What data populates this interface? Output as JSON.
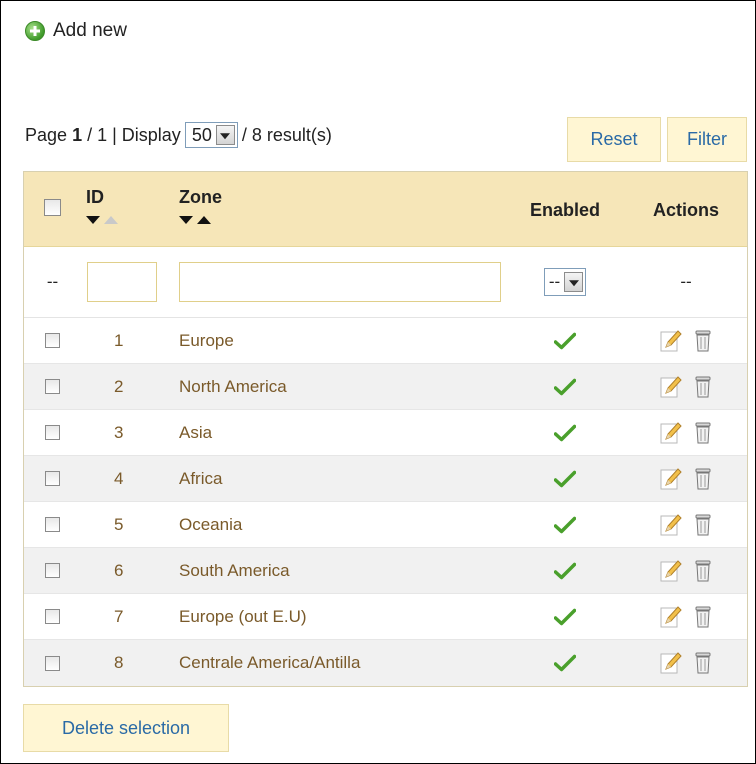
{
  "toolbar": {
    "add_new_label": "Add new"
  },
  "pagination": {
    "page_label": "Page",
    "current_page": "1",
    "separator": "/ 1 | Display",
    "display_value": "50",
    "results_text": "/ 8 result(s)"
  },
  "buttons": {
    "reset": "Reset",
    "filter": "Filter",
    "delete_selection": "Delete selection"
  },
  "table": {
    "headers": {
      "id": "ID",
      "zone": "Zone",
      "enabled": "Enabled",
      "actions": "Actions"
    },
    "filter": {
      "dash_left": "--",
      "enabled_select": "--",
      "dash_right": "--",
      "id_value": "",
      "zone_value": ""
    },
    "rows": [
      {
        "id": "1",
        "zone": "Europe",
        "enabled": true
      },
      {
        "id": "2",
        "zone": "North America",
        "enabled": true
      },
      {
        "id": "3",
        "zone": "Asia",
        "enabled": true
      },
      {
        "id": "4",
        "zone": "Africa",
        "enabled": true
      },
      {
        "id": "5",
        "zone": "Oceania",
        "enabled": true
      },
      {
        "id": "6",
        "zone": "South America",
        "enabled": true
      },
      {
        "id": "7",
        "zone": "Europe (out E.U)",
        "enabled": true
      },
      {
        "id": "8",
        "zone": "Centrale America/Antilla",
        "enabled": true
      }
    ]
  },
  "colors": {
    "header_bg": "#f6e6b8",
    "button_bg": "#fff6d3",
    "link_blue": "#2a6aa6",
    "zone_text": "#7a5a2a",
    "check_green": "#4aa02c"
  },
  "icons": {
    "add": "plus-circle-icon",
    "enabled": "checkmark-icon",
    "edit": "pencil-icon",
    "delete": "trash-icon"
  }
}
